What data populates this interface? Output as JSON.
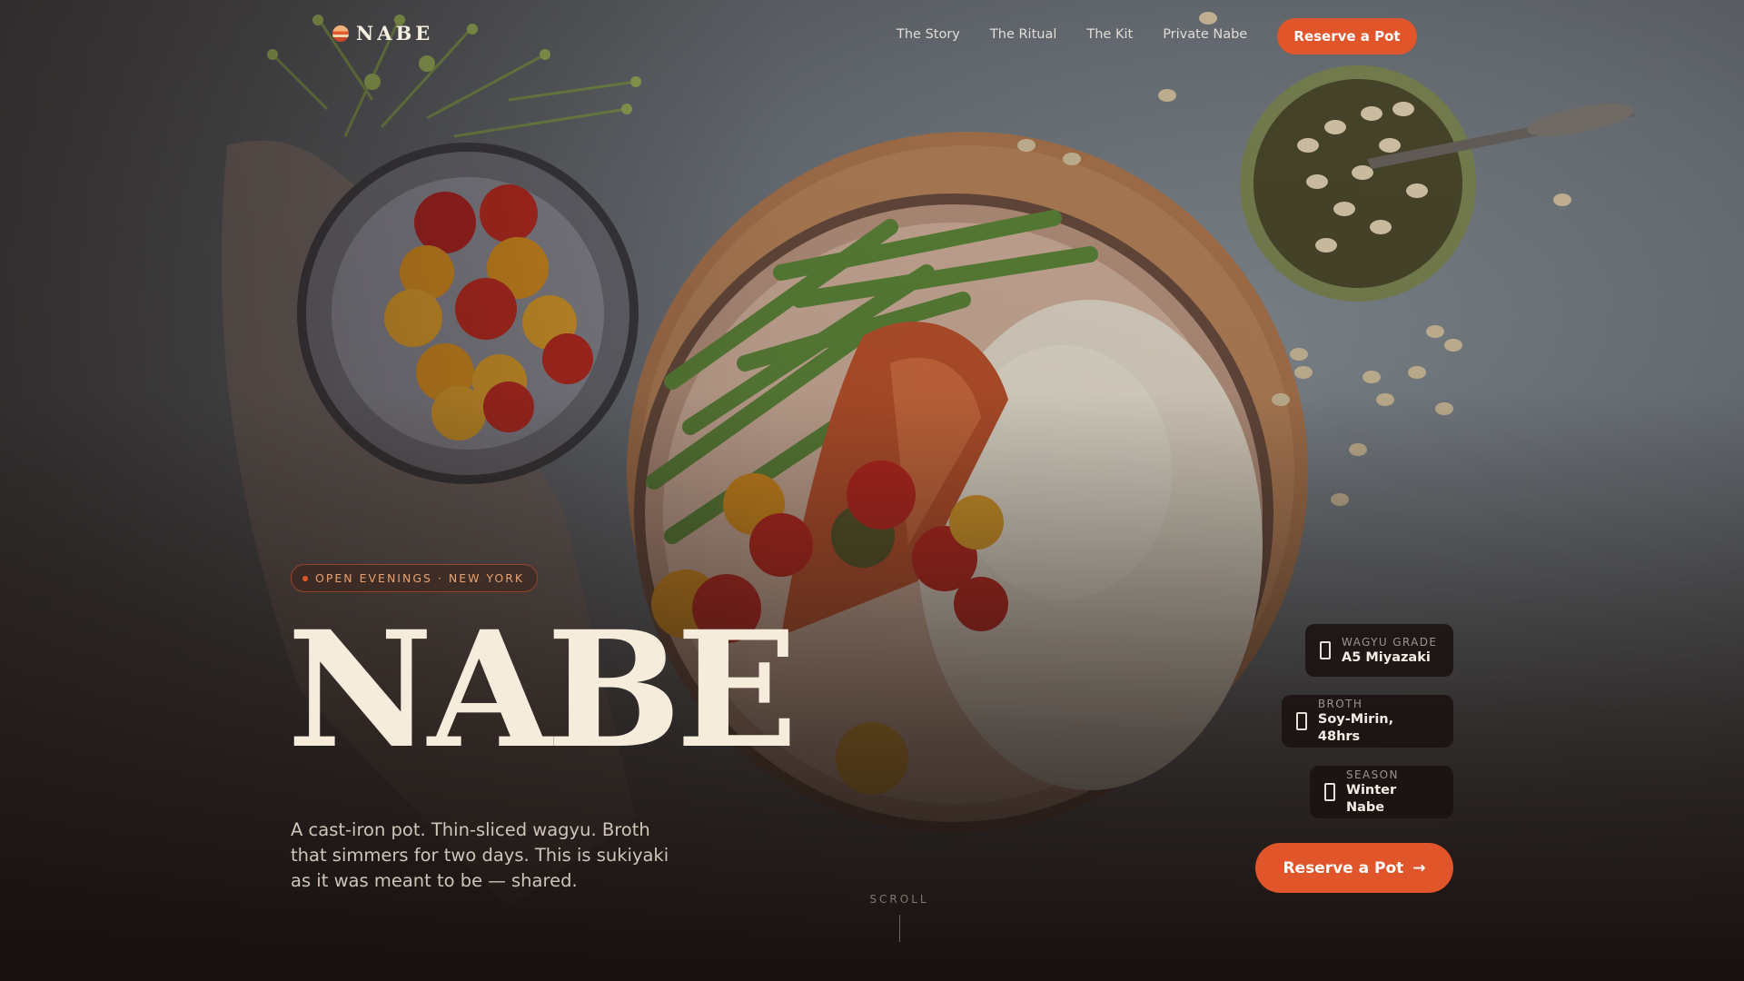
{
  "brand": {
    "name": "NABE"
  },
  "nav": {
    "links": [
      "The Story",
      "The Ritual",
      "The Kit",
      "Private Nabe"
    ],
    "cta_label": "Reserve a Pot"
  },
  "hero": {
    "badge": "OPEN EVENINGS · NEW YORK",
    "headline": "NABE",
    "lede": "A cast-iron pot. Thin-sliced wagyu. Broth that simmers for two days. This is sukiyaki as it was meant to be — shared.",
    "cta_label": "Reserve a Pot",
    "scroll_label": "SCROLL"
  },
  "stats": [
    {
      "label": "WAGYU GRADE",
      "value": "A5 Miyazaki"
    },
    {
      "label": "BROTH",
      "value": "Soy-Mirin, 48hrs"
    },
    {
      "label": "SEASON",
      "value": "Winter Nabe"
    }
  ],
  "colors": {
    "accent": "#e0552a",
    "headline": "#f6ecdc",
    "background": "#1d1614"
  }
}
